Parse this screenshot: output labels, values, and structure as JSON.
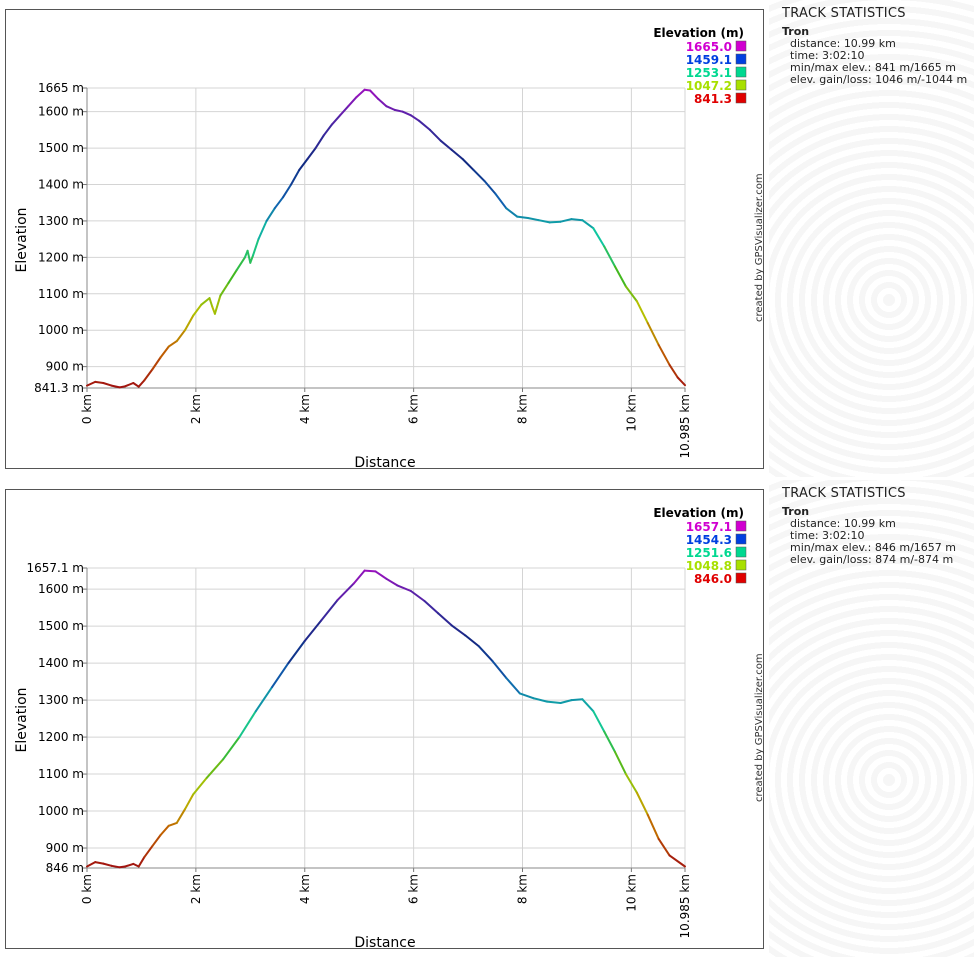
{
  "charts": [
    {
      "stats": {
        "heading": "TRACK STATISTICS",
        "track_name": "Tron",
        "lines": [
          "distance: 10.99 km",
          "time: 3:02:10",
          "min/max elev.: 841 m/1665 m",
          "elev. gain/loss: 1046 m/-1044 m"
        ]
      },
      "credit": "created by GPSVisualizer.com"
    },
    {
      "stats": {
        "heading": "TRACK STATISTICS",
        "track_name": "Tron",
        "lines": [
          "distance: 10.99 km",
          "time: 3:02:10",
          "min/max elev.: 846 m/1657 m",
          "elev. gain/loss: 874 m/-874 m"
        ]
      },
      "credit": "created by GPSVisualizer.com"
    }
  ],
  "chart_data": [
    {
      "type": "line",
      "xlabel": "Distance",
      "ylabel": "Elevation",
      "xlim": [
        0,
        10.985
      ],
      "ylim": [
        841.3,
        1665
      ],
      "x_ticks": [
        {
          "v": 0,
          "label": "0 km"
        },
        {
          "v": 2,
          "label": "2 km"
        },
        {
          "v": 4,
          "label": "4 km"
        },
        {
          "v": 6,
          "label": "6 km"
        },
        {
          "v": 8,
          "label": "8 km"
        },
        {
          "v": 10,
          "label": "10 km"
        },
        {
          "v": 10.985,
          "label": "10.985 km"
        }
      ],
      "y_ticks": [
        {
          "v": 841.3,
          "label": "841.3 m"
        },
        {
          "v": 900,
          "label": "900 m"
        },
        {
          "v": 1000,
          "label": "1000 m"
        },
        {
          "v": 1100,
          "label": "1100 m"
        },
        {
          "v": 1200,
          "label": "1200 m"
        },
        {
          "v": 1300,
          "label": "1300 m"
        },
        {
          "v": 1400,
          "label": "1400 m"
        },
        {
          "v": 1500,
          "label": "1500 m"
        },
        {
          "v": 1600,
          "label": "1600 m"
        },
        {
          "v": 1665,
          "label": "1665 m"
        }
      ],
      "legend": {
        "title": "Elevation (m)",
        "placement": "top-right",
        "entries": [
          {
            "label": "1665.0",
            "color": "#d000d0"
          },
          {
            "label": "1459.1",
            "color": "#0040e0"
          },
          {
            "label": "1253.1",
            "color": "#00d890"
          },
          {
            "label": "1047.2",
            "color": "#a8e000"
          },
          {
            "label": "841.3",
            "color": "#e00000"
          }
        ]
      },
      "color_stops": [
        {
          "v": 841.3,
          "color": "#a01010"
        },
        {
          "v": 944,
          "color": "#c06000"
        },
        {
          "v": 1047.2,
          "color": "#b8c000"
        },
        {
          "v": 1150,
          "color": "#40b820"
        },
        {
          "v": 1253.1,
          "color": "#10c8a0"
        },
        {
          "v": 1356,
          "color": "#1060b0"
        },
        {
          "v": 1459.1,
          "color": "#102880"
        },
        {
          "v": 1560,
          "color": "#4028a0"
        },
        {
          "v": 1665,
          "color": "#a010c0"
        }
      ],
      "x": [
        0,
        0.15,
        0.3,
        0.45,
        0.6,
        0.7,
        0.85,
        0.95,
        1.05,
        1.2,
        1.35,
        1.5,
        1.65,
        1.8,
        1.95,
        2.1,
        2.25,
        2.3,
        2.35,
        2.45,
        2.6,
        2.75,
        2.9,
        2.95,
        3.0,
        3.05,
        3.15,
        3.3,
        3.45,
        3.6,
        3.75,
        3.9,
        4.05,
        4.2,
        4.35,
        4.5,
        4.65,
        4.8,
        4.95,
        5.1,
        5.2,
        5.35,
        5.5,
        5.65,
        5.8,
        5.95,
        6.1,
        6.3,
        6.5,
        6.7,
        6.9,
        7.1,
        7.3,
        7.5,
        7.7,
        7.9,
        8.1,
        8.3,
        8.5,
        8.7,
        8.9,
        9.1,
        9.3,
        9.5,
        9.7,
        9.9,
        10.1,
        10.3,
        10.5,
        10.7,
        10.85,
        10.985
      ],
      "y": [
        848,
        858,
        855,
        848,
        843,
        846,
        855,
        845,
        862,
        892,
        925,
        955,
        970,
        1000,
        1040,
        1070,
        1088,
        1065,
        1045,
        1095,
        1130,
        1165,
        1200,
        1218,
        1185,
        1205,
        1250,
        1300,
        1335,
        1365,
        1400,
        1440,
        1470,
        1500,
        1535,
        1565,
        1590,
        1615,
        1640,
        1660,
        1658,
        1635,
        1615,
        1605,
        1600,
        1590,
        1575,
        1550,
        1520,
        1495,
        1470,
        1440,
        1410,
        1375,
        1335,
        1312,
        1308,
        1302,
        1296,
        1298,
        1305,
        1302,
        1280,
        1230,
        1175,
        1120,
        1080,
        1020,
        960,
        905,
        870,
        849
      ]
    },
    {
      "type": "line",
      "xlabel": "Distance",
      "ylabel": "Elevation",
      "xlim": [
        0,
        10.985
      ],
      "ylim": [
        846,
        1657.1
      ],
      "x_ticks": [
        {
          "v": 0,
          "label": "0 km"
        },
        {
          "v": 2,
          "label": "2 km"
        },
        {
          "v": 4,
          "label": "4 km"
        },
        {
          "v": 6,
          "label": "6 km"
        },
        {
          "v": 8,
          "label": "8 km"
        },
        {
          "v": 10,
          "label": "10 km"
        },
        {
          "v": 10.985,
          "label": "10.985 km"
        }
      ],
      "y_ticks": [
        {
          "v": 846,
          "label": "846 m"
        },
        {
          "v": 900,
          "label": "900 m"
        },
        {
          "v": 1000,
          "label": "1000 m"
        },
        {
          "v": 1100,
          "label": "1100 m"
        },
        {
          "v": 1200,
          "label": "1200 m"
        },
        {
          "v": 1300,
          "label": "1300 m"
        },
        {
          "v": 1400,
          "label": "1400 m"
        },
        {
          "v": 1500,
          "label": "1500 m"
        },
        {
          "v": 1600,
          "label": "1600 m"
        },
        {
          "v": 1657.1,
          "label": "1657.1 m"
        }
      ],
      "legend": {
        "title": "Elevation (m)",
        "placement": "top-right",
        "entries": [
          {
            "label": "1657.1",
            "color": "#d000d0"
          },
          {
            "label": "1454.3",
            "color": "#0040e0"
          },
          {
            "label": "1251.6",
            "color": "#00d890"
          },
          {
            "label": "1048.8",
            "color": "#a8e000"
          },
          {
            "label": "846.0",
            "color": "#e00000"
          }
        ]
      },
      "color_stops": [
        {
          "v": 846,
          "color": "#a01010"
        },
        {
          "v": 947,
          "color": "#c06000"
        },
        {
          "v": 1048.8,
          "color": "#b8c000"
        },
        {
          "v": 1150,
          "color": "#40b820"
        },
        {
          "v": 1251.6,
          "color": "#10c8a0"
        },
        {
          "v": 1353,
          "color": "#1060b0"
        },
        {
          "v": 1454.3,
          "color": "#102880"
        },
        {
          "v": 1555,
          "color": "#4028a0"
        },
        {
          "v": 1657.1,
          "color": "#a010c0"
        }
      ],
      "x": [
        0,
        0.15,
        0.3,
        0.45,
        0.6,
        0.7,
        0.85,
        0.95,
        1.05,
        1.2,
        1.35,
        1.5,
        1.65,
        1.8,
        1.95,
        2.2,
        2.5,
        2.8,
        3.1,
        3.4,
        3.7,
        4.0,
        4.3,
        4.6,
        4.9,
        5.1,
        5.3,
        5.5,
        5.7,
        5.95,
        6.2,
        6.45,
        6.7,
        6.95,
        7.2,
        7.45,
        7.7,
        7.95,
        8.2,
        8.45,
        8.7,
        8.9,
        9.1,
        9.3,
        9.5,
        9.7,
        9.9,
        10.1,
        10.3,
        10.5,
        10.7,
        10.985
      ],
      "y": [
        850,
        862,
        858,
        852,
        848,
        850,
        857,
        850,
        875,
        905,
        935,
        960,
        968,
        1005,
        1045,
        1090,
        1140,
        1200,
        1270,
        1335,
        1400,
        1460,
        1515,
        1570,
        1615,
        1650,
        1648,
        1628,
        1610,
        1595,
        1568,
        1535,
        1502,
        1475,
        1445,
        1405,
        1360,
        1318,
        1305,
        1296,
        1292,
        1300,
        1302,
        1270,
        1215,
        1160,
        1100,
        1050,
        990,
        925,
        880,
        850
      ]
    }
  ]
}
